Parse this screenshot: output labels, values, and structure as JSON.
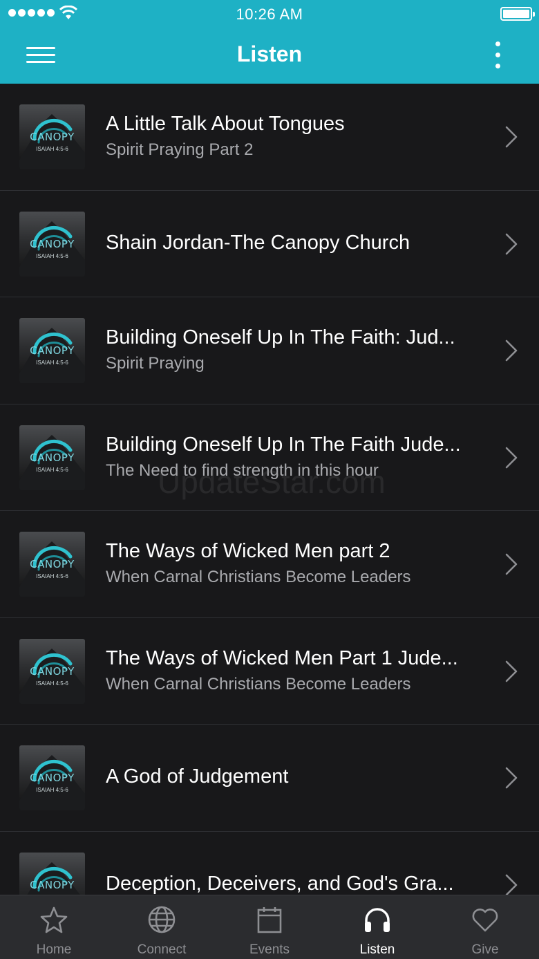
{
  "status_bar": {
    "time": "10:26 AM"
  },
  "nav": {
    "title": "Listen"
  },
  "thumbnail": {
    "brand": "CANOPY",
    "verse": "ISAIAH 4:5-6"
  },
  "items": [
    {
      "title": "A Little Talk About Tongues",
      "subtitle": "Spirit Praying Part 2"
    },
    {
      "title": "Shain Jordan-The Canopy Church",
      "subtitle": ""
    },
    {
      "title": "Building Oneself Up In The Faith: Jud...",
      "subtitle": "Spirit Praying"
    },
    {
      "title": "Building Oneself Up In The Faith Jude...",
      "subtitle": "The Need to find strength in this hour"
    },
    {
      "title": "The Ways of Wicked Men part 2",
      "subtitle": "When Carnal Christians Become Leaders"
    },
    {
      "title": "The Ways of Wicked Men Part 1 Jude...",
      "subtitle": "When Carnal Christians Become Leaders"
    },
    {
      "title": "A God of Judgement",
      "subtitle": ""
    },
    {
      "title": "Deception, Deceivers, and God's Gra...",
      "subtitle": ""
    }
  ],
  "watermark": "UpdateStar.com",
  "tabs": [
    {
      "label": "Home",
      "icon": "star-icon",
      "active": false
    },
    {
      "label": "Connect",
      "icon": "globe-icon",
      "active": false
    },
    {
      "label": "Events",
      "icon": "calendar-icon",
      "active": false
    },
    {
      "label": "Listen",
      "icon": "headphones-icon",
      "active": true
    },
    {
      "label": "Give",
      "icon": "heart-icon",
      "active": false
    }
  ],
  "colors": {
    "accent": "#1eb1c5",
    "background": "#18181a",
    "tab_bar": "#2b2c2f"
  }
}
